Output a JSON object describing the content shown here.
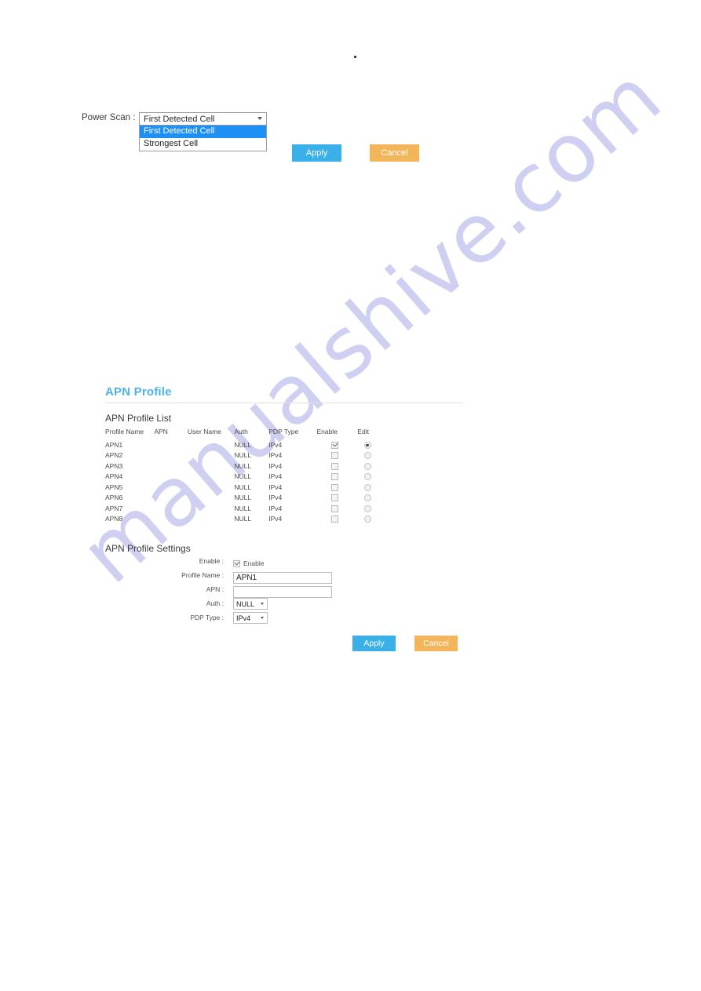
{
  "power_scan": {
    "label": "Power Scan :",
    "selected": "First Detected Cell",
    "options": [
      "First Detected Cell",
      "Strongest Cell"
    ]
  },
  "top_buttons": {
    "apply": "Apply",
    "cancel": "Cancel"
  },
  "apn": {
    "heading": "APN Profile",
    "list_title": "APN Profile List",
    "settings_title": "APN Profile Settings",
    "columns": [
      "Profile Name",
      "APN",
      "User Name",
      "Auth",
      "PDP Type",
      "Enable",
      "Edit"
    ],
    "rows": [
      {
        "profile_name": "APN1",
        "apn": "",
        "user_name": "",
        "auth": "NULL",
        "pdp_type": "IPv4",
        "enabled": true,
        "selected": true
      },
      {
        "profile_name": "APN2",
        "apn": "",
        "user_name": "",
        "auth": "NULL",
        "pdp_type": "IPv4",
        "enabled": false,
        "selected": false
      },
      {
        "profile_name": "APN3",
        "apn": "",
        "user_name": "",
        "auth": "NULL",
        "pdp_type": "IPv4",
        "enabled": false,
        "selected": false
      },
      {
        "profile_name": "APN4",
        "apn": "",
        "user_name": "",
        "auth": "NULL",
        "pdp_type": "IPv4",
        "enabled": false,
        "selected": false
      },
      {
        "profile_name": "APN5",
        "apn": "",
        "user_name": "",
        "auth": "NULL",
        "pdp_type": "IPv4",
        "enabled": false,
        "selected": false
      },
      {
        "profile_name": "APN6",
        "apn": "",
        "user_name": "",
        "auth": "NULL",
        "pdp_type": "IPv4",
        "enabled": false,
        "selected": false
      },
      {
        "profile_name": "APN7",
        "apn": "",
        "user_name": "",
        "auth": "NULL",
        "pdp_type": "IPv4",
        "enabled": false,
        "selected": false
      },
      {
        "profile_name": "APN8",
        "apn": "",
        "user_name": "",
        "auth": "NULL",
        "pdp_type": "IPv4",
        "enabled": false,
        "selected": false
      }
    ],
    "settings": {
      "enable_label": "Enable :",
      "enable_checkbox_text": "Enable",
      "enable_checked": true,
      "profile_name_label": "Profile Name :",
      "profile_name_value": "APN1",
      "apn_label": "APN :",
      "apn_value": "",
      "auth_label": "Auth :",
      "auth_value": "NULL",
      "pdp_label": "PDP Type :",
      "pdp_value": "IPv4"
    },
    "buttons": {
      "apply": "Apply",
      "cancel": "Cancel"
    }
  },
  "watermark": {
    "text": "manualshive.com",
    "color": "#cdcdf2"
  },
  "colors": {
    "heading_blue": "#4eb3e4",
    "apply_blue": "#3ab0e8",
    "cancel_orange": "#f3b55a",
    "option_highlight": "#1e90f5"
  }
}
